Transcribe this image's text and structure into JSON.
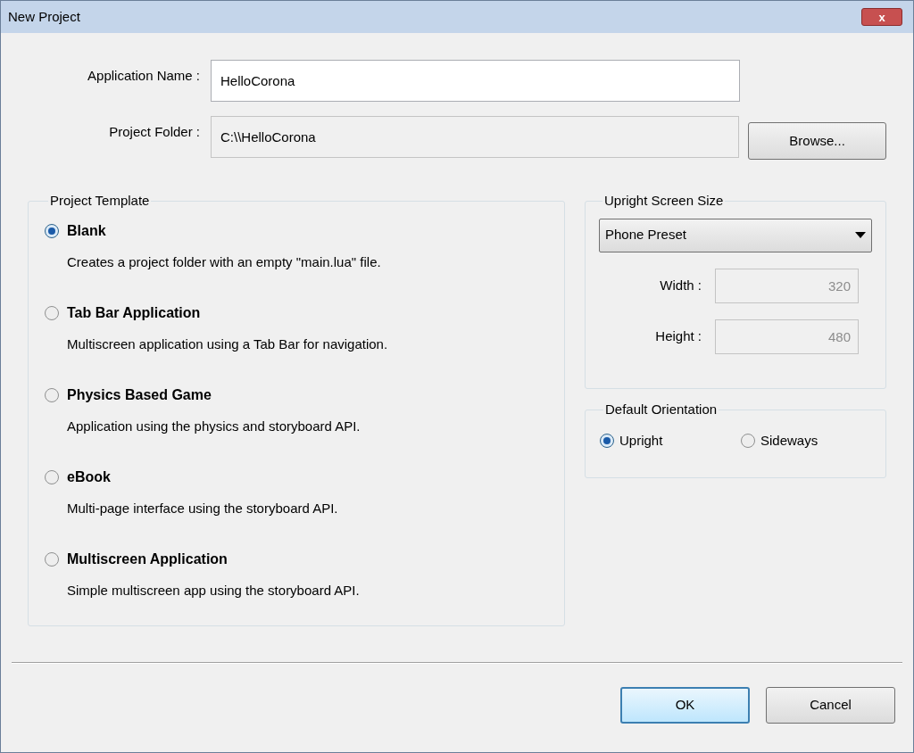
{
  "window": {
    "title": "New Project",
    "close": "x"
  },
  "application_name": {
    "label": "Application Name :",
    "value": "HelloCorona"
  },
  "project_folder": {
    "label": "Project Folder :",
    "value": "C:\\\\HelloCorona",
    "disabled": true
  },
  "browse_button": "Browse...",
  "project_template": {
    "title": "Project Template",
    "options": [
      {
        "label": "Blank",
        "description": "Creates a project folder with an empty \"main.lua\" file.",
        "selected": true
      },
      {
        "label": "Tab Bar Application",
        "description": "Multiscreen application using a Tab Bar for navigation.",
        "selected": false
      },
      {
        "label": "Physics Based Game",
        "description": "Application using the physics and storyboard API.",
        "selected": false
      },
      {
        "label": "eBook",
        "description": "Multi-page interface using the storyboard API.",
        "selected": false
      },
      {
        "label": "Multiscreen Application",
        "description": "Simple multiscreen app using the storyboard API.",
        "selected": false
      }
    ]
  },
  "upright_screen_size": {
    "title": "Upright Screen Size",
    "preset": "Phone Preset",
    "width": {
      "label": "Width :",
      "value": "320",
      "disabled": true
    },
    "height": {
      "label": "Height :",
      "value": "480",
      "disabled": true
    }
  },
  "default_orientation": {
    "title": "Default Orientation",
    "options": [
      {
        "label": "Upright",
        "selected": true
      },
      {
        "label": "Sideways",
        "selected": false
      }
    ]
  },
  "buttons": [
    {
      "label": "OK",
      "default": true
    },
    {
      "label": "Cancel",
      "default": false
    }
  ]
}
